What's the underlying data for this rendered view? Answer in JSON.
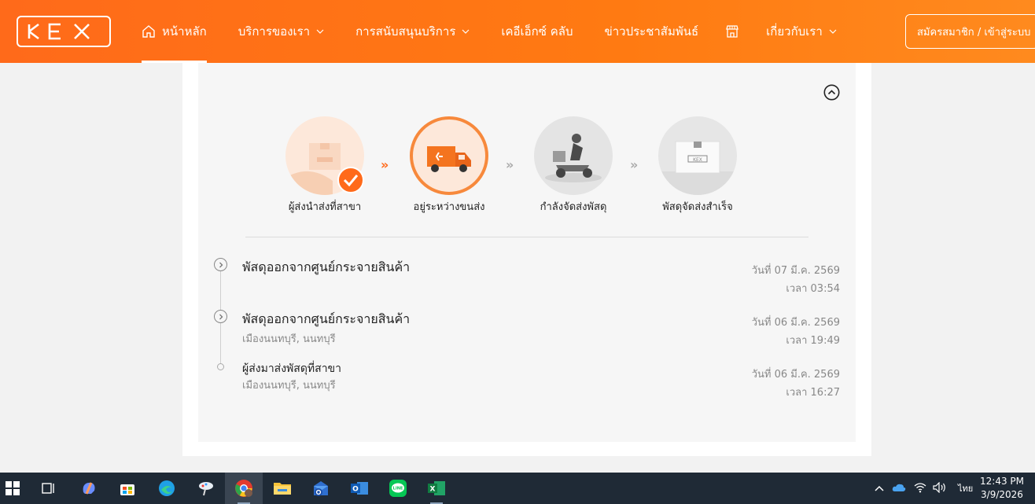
{
  "header": {
    "logo_text": "KEX",
    "nav": [
      {
        "label": "หน้าหลัก",
        "active": true,
        "has_dropdown": false
      },
      {
        "label": "บริการของเรา",
        "active": false,
        "has_dropdown": true
      },
      {
        "label": "การสนับสนุนบริการ",
        "active": false,
        "has_dropdown": true
      },
      {
        "label": "เคอีเอ็กซ์ คลับ",
        "active": false,
        "has_dropdown": false
      },
      {
        "label": "ข่าวประชาสัมพันธ์",
        "active": false,
        "has_dropdown": false
      },
      {
        "label": "เกี่ยวกับเรา",
        "active": false,
        "has_dropdown": true
      }
    ],
    "login_label": "สมัครสมาชิก / เข้าสู่ระบบ"
  },
  "steps": [
    {
      "label": "ผู้ส่งนำส่งที่สาขา",
      "status": "done"
    },
    {
      "label": "อยู่ระหว่างขนส่ง",
      "status": "current"
    },
    {
      "label": "กำลังจัดส่งพัสดุ",
      "status": "pending"
    },
    {
      "label": "พัสดุจัดส่งสำเร็จ",
      "status": "pending"
    }
  ],
  "events": [
    {
      "title": "พัสดุออกจากศูนย์กระจายสินค้า",
      "location": "",
      "date": "วันที่ 07 มี.ค. 2569",
      "time": "เวลา 03:54"
    },
    {
      "title": "พัสดุออกจากศูนย์กระจายสินค้า",
      "location": "เมืองนนทบุรี, นนทบุรี",
      "date": "วันที่ 06 มี.ค. 2569",
      "time": "เวลา 19:49"
    },
    {
      "title": "ผู้ส่งมาส่งพัสดุที่สาขา",
      "location": "เมืองนนทบุรี, นนทบุรี",
      "date": "วันที่ 06 มี.ค. 2569",
      "time": "เวลา 16:27"
    }
  ],
  "colors": {
    "brand": "#ff6a1a",
    "muted": "#888888"
  },
  "taskbar": {
    "language": "ไทย",
    "time": "12:43 PM",
    "date": "3/9/2026"
  }
}
